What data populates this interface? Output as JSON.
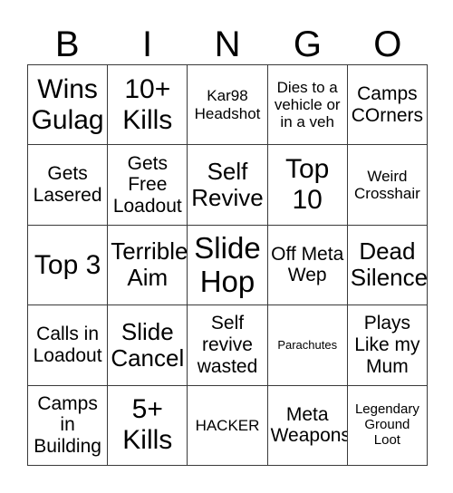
{
  "card": {
    "header_letters": [
      "B",
      "I",
      "N",
      "G",
      "O"
    ],
    "border_color": "#3a3a3a",
    "background_color": "#ffffff",
    "text_color": "#000000",
    "rows": 5,
    "columns": 5,
    "cells": [
      {
        "text": "Wins Gulag",
        "size": "xxl"
      },
      {
        "text": "10+ Kills",
        "size": "xxl"
      },
      {
        "text": "Kar98 Headshot",
        "size": "md"
      },
      {
        "text": "Dies to a vehicle or in a veh",
        "size": "md"
      },
      {
        "text": "Camps COrners",
        "size": "lg"
      },
      {
        "text": "Gets Lasered",
        "size": "lg"
      },
      {
        "text": "Gets Free Loadout",
        "size": "lg"
      },
      {
        "text": "Self Revive",
        "size": "xl"
      },
      {
        "text": "Top 10",
        "size": "xxl"
      },
      {
        "text": "Weird Crosshair",
        "size": "md"
      },
      {
        "text": "Top 3",
        "size": "xxl"
      },
      {
        "text": "Terrible Aim",
        "size": "xl"
      },
      {
        "text": "Slide Hop",
        "size": "mega"
      },
      {
        "text": "Off Meta Wep",
        "size": "lg"
      },
      {
        "text": "Dead Silence",
        "size": "xl"
      },
      {
        "text": "Calls in Loadout",
        "size": "lg"
      },
      {
        "text": "Slide Cancel",
        "size": "xl"
      },
      {
        "text": "Self revive wasted",
        "size": "lg"
      },
      {
        "text": "Parachutes",
        "size": "xs"
      },
      {
        "text": "Plays Like my Mum",
        "size": "lg"
      },
      {
        "text": "Camps in Building",
        "size": "lg"
      },
      {
        "text": "5+ Kills",
        "size": "xxl"
      },
      {
        "text": "HACKER",
        "size": "md"
      },
      {
        "text": "Meta Weapons",
        "size": "lg"
      },
      {
        "text": "Legendary Ground Loot",
        "size": "sm"
      }
    ]
  }
}
